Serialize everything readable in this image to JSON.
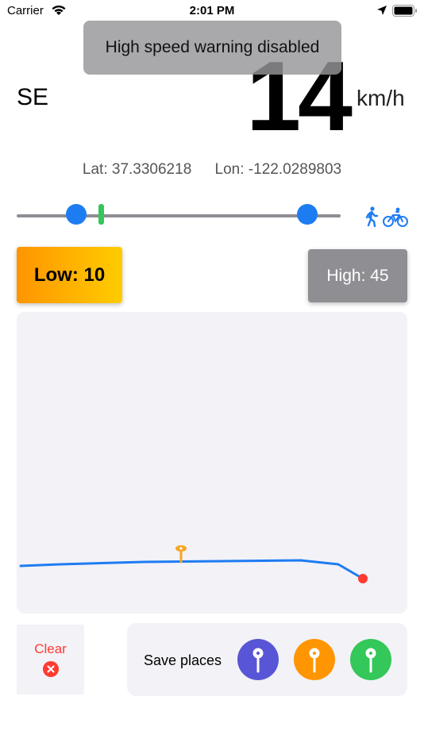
{
  "status_bar": {
    "carrier": "Carrier",
    "time": "2:01 PM"
  },
  "toast": {
    "message": "High speed warning disabled"
  },
  "speed": {
    "heading": "SE",
    "value": "14",
    "unit": "km/h"
  },
  "location": {
    "lat": "Lat: 37.3306218",
    "lon": "Lon: -122.0289803"
  },
  "thresholds": {
    "low_label": "Low: 10",
    "high_label": "High: 45",
    "low_value": 10,
    "high_value": 45,
    "current_speed": 14
  },
  "activity_icons": [
    "walking-icon",
    "bicycle-icon"
  ],
  "map": {
    "start_marker_color": "#ff3b30",
    "route_color": "#1e7cf2",
    "pin_color": "#f5a623"
  },
  "actions": {
    "clear_label": "Clear",
    "save_places_label": "Save places"
  },
  "pin_colors": {
    "purple": "#5856d6",
    "orange": "#ff9500",
    "green": "#34c759"
  },
  "colors": {
    "accent": "#1e7cf2",
    "low_gradient": [
      "#ff9500",
      "#ffcc00"
    ],
    "high_bg": "#8e8e93"
  }
}
